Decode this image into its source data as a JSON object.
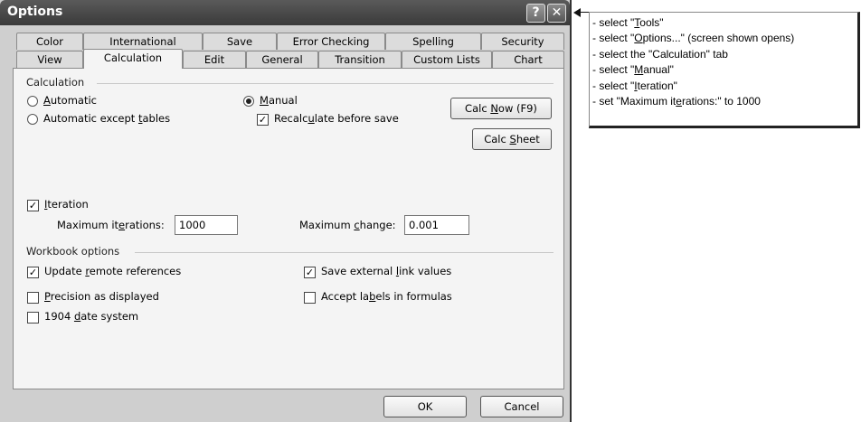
{
  "window": {
    "title": "Options",
    "help_glyph": "?",
    "close_glyph": "✕"
  },
  "tabs_row_back": [
    "Color",
    "International",
    "Save",
    "Error Checking",
    "Spelling",
    "Security"
  ],
  "tabs_row_front": [
    "View",
    "Calculation",
    "Edit",
    "General",
    "Transition",
    "Custom Lists",
    "Chart"
  ],
  "active_tab": "Calculation",
  "calculation": {
    "group_label": "Calculation",
    "automatic": {
      "pre": "",
      "key": "A",
      "post": "utomatic",
      "checked": false
    },
    "automatic_except": {
      "pre": "Automatic except ",
      "key": "t",
      "post": "ables",
      "checked": false
    },
    "manual": {
      "pre": "",
      "key": "M",
      "post": "anual",
      "checked": true
    },
    "recalc": {
      "pre": "Recalc",
      "key": "u",
      "post": "late before save",
      "checked": true
    },
    "calc_now": {
      "pre": "Calc ",
      "key": "N",
      "post": "ow (F9)"
    },
    "calc_sheet": {
      "pre": "Calc ",
      "key": "S",
      "post": "heet"
    }
  },
  "iteration": {
    "checkbox": {
      "pre": "",
      "key": "I",
      "post": "teration",
      "checked": true
    },
    "max_iter_label": {
      "pre": "Maximum it",
      "key": "e",
      "post": "rations:"
    },
    "max_iter_value": "1000",
    "max_change_label": {
      "pre": "Maximum ",
      "key": "c",
      "post": "hange:"
    },
    "max_change_value": "0.001"
  },
  "workbook": {
    "group_label": "Workbook options",
    "update_remote": {
      "pre": "Update ",
      "key": "r",
      "post": "emote references",
      "checked": true
    },
    "save_external": {
      "pre": "Save external ",
      "key": "l",
      "post": "ink values",
      "checked": true
    },
    "precision": {
      "pre": "",
      "key": "P",
      "post": "recision as displayed",
      "checked": false
    },
    "accept_labels": {
      "pre": "Accept la",
      "key": "b",
      "post": "els in formulas",
      "checked": false
    },
    "date1904": {
      "pre": "1904 ",
      "key": "d",
      "post": "ate system",
      "checked": false
    }
  },
  "buttons": {
    "ok": "OK",
    "cancel": "Cancel"
  },
  "instructions": [
    {
      "pre": "- select \"",
      "key": "T",
      "post": "ools\""
    },
    {
      "pre": "- select \"",
      "key": "O",
      "post": "ptions...\" (screen shown opens)"
    },
    {
      "pre": "- select the \"Calculation\" tab",
      "key": "",
      "post": ""
    },
    {
      "pre": "- select \"",
      "key": "M",
      "post": "anual\""
    },
    {
      "pre": "- select \"",
      "key": "I",
      "post": "teration\""
    },
    {
      "pre": "- set \"Maximum it",
      "key": "e",
      "post": "rations:\" to 1000"
    }
  ]
}
